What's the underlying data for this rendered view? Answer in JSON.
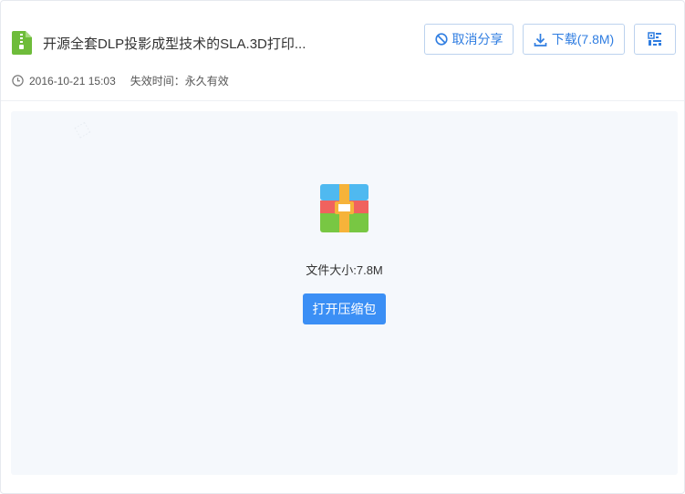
{
  "file": {
    "title": "开源全套DLP投影成型技术的SLA.3D打印...",
    "date": "2016-10-21 15:03",
    "expiry": "失效时间：永久有效",
    "size_text": "文件大小:7.8M"
  },
  "actions": {
    "cancel_share": "取消分享",
    "download": "下载(7.8M)",
    "open_zip": "打开压缩包"
  },
  "icons": {
    "file_type": "zip-file-icon",
    "clock": "clock-icon",
    "cancel": "ban-icon",
    "download": "download-icon",
    "qr": "qr-code-icon",
    "archive": "archive-icon"
  },
  "colors": {
    "accent": "#2f7de1",
    "primary_button": "#3b8ff5",
    "content_bg": "#f5f8fc"
  }
}
